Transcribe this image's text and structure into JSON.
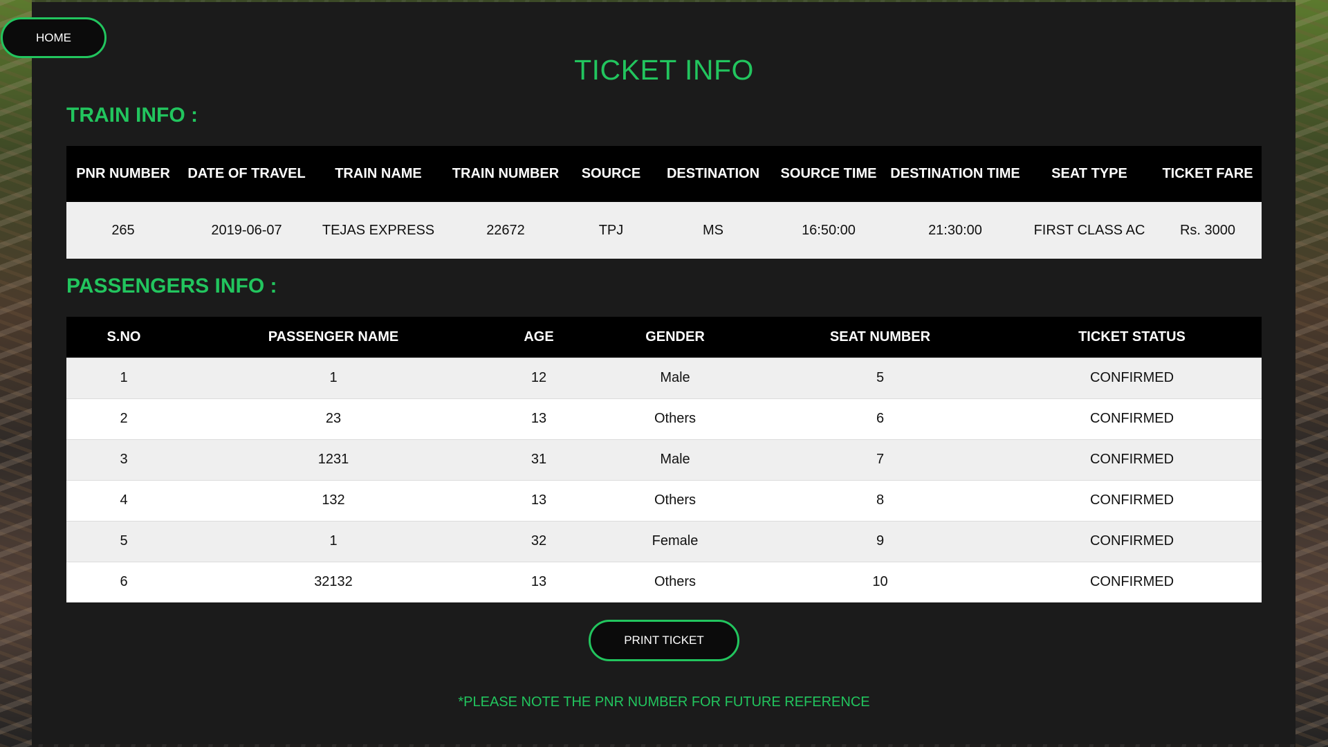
{
  "nav": {
    "home_label": "HOME"
  },
  "page": {
    "title": "TICKET INFO",
    "train_section_title": "TRAIN INFO :",
    "passengers_section_title": "PASSENGERS INFO :",
    "print_label": "PRINT TICKET",
    "note": "*PLEASE NOTE THE PNR NUMBER FOR FUTURE REFERENCE"
  },
  "colors": {
    "accent": "#22c55e",
    "panel": "#1b1b1b",
    "header": "#000000"
  },
  "train": {
    "columns": [
      "PNR NUMBER",
      "DATE OF TRAVEL",
      "TRAIN NAME",
      "TRAIN NUMBER",
      "SOURCE",
      "DESTINATION",
      "SOURCE TIME",
      "DESTINATION TIME",
      "SEAT TYPE",
      "TICKET FARE"
    ],
    "row": [
      "265",
      "2019-06-07",
      "TEJAS EXPRESS",
      "22672",
      "TPJ",
      "MS",
      "16:50:00",
      "21:30:00",
      "FIRST CLASS AC",
      "Rs. 3000"
    ]
  },
  "passengers": {
    "columns": [
      "S.NO",
      "PASSENGER NAME",
      "AGE",
      "GENDER",
      "SEAT NUMBER",
      "TICKET STATUS"
    ],
    "rows": [
      [
        "1",
        "1",
        "12",
        "Male",
        "5",
        "CONFIRMED"
      ],
      [
        "2",
        "23",
        "13",
        "Others",
        "6",
        "CONFIRMED"
      ],
      [
        "3",
        "1231",
        "31",
        "Male",
        "7",
        "CONFIRMED"
      ],
      [
        "4",
        "132",
        "13",
        "Others",
        "8",
        "CONFIRMED"
      ],
      [
        "5",
        "1",
        "32",
        "Female",
        "9",
        "CONFIRMED"
      ],
      [
        "6",
        "32132",
        "13",
        "Others",
        "10",
        "CONFIRMED"
      ]
    ]
  }
}
